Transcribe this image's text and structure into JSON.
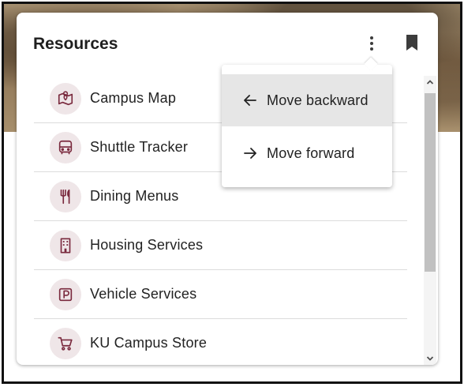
{
  "card": {
    "title": "Resources"
  },
  "resources": {
    "items": [
      {
        "label": "Campus Map",
        "icon": "map-icon"
      },
      {
        "label": "Shuttle Tracker",
        "icon": "bus-icon"
      },
      {
        "label": "Dining Menus",
        "icon": "utensils-icon"
      },
      {
        "label": "Housing Services",
        "icon": "building-icon"
      },
      {
        "label": "Vehicle Services",
        "icon": "parking-icon"
      },
      {
        "label": "KU Campus Store",
        "icon": "cart-icon"
      }
    ]
  },
  "menu": {
    "items": [
      {
        "label": "Move backward",
        "icon": "arrow-left-icon",
        "highlighted": true
      },
      {
        "label": "Move forward",
        "icon": "arrow-right-icon",
        "highlighted": false
      }
    ]
  },
  "colors": {
    "icon_accent": "#7a2a3e",
    "icon_bg": "#efe6e8",
    "menu_highlight": "#e6e6e6"
  }
}
